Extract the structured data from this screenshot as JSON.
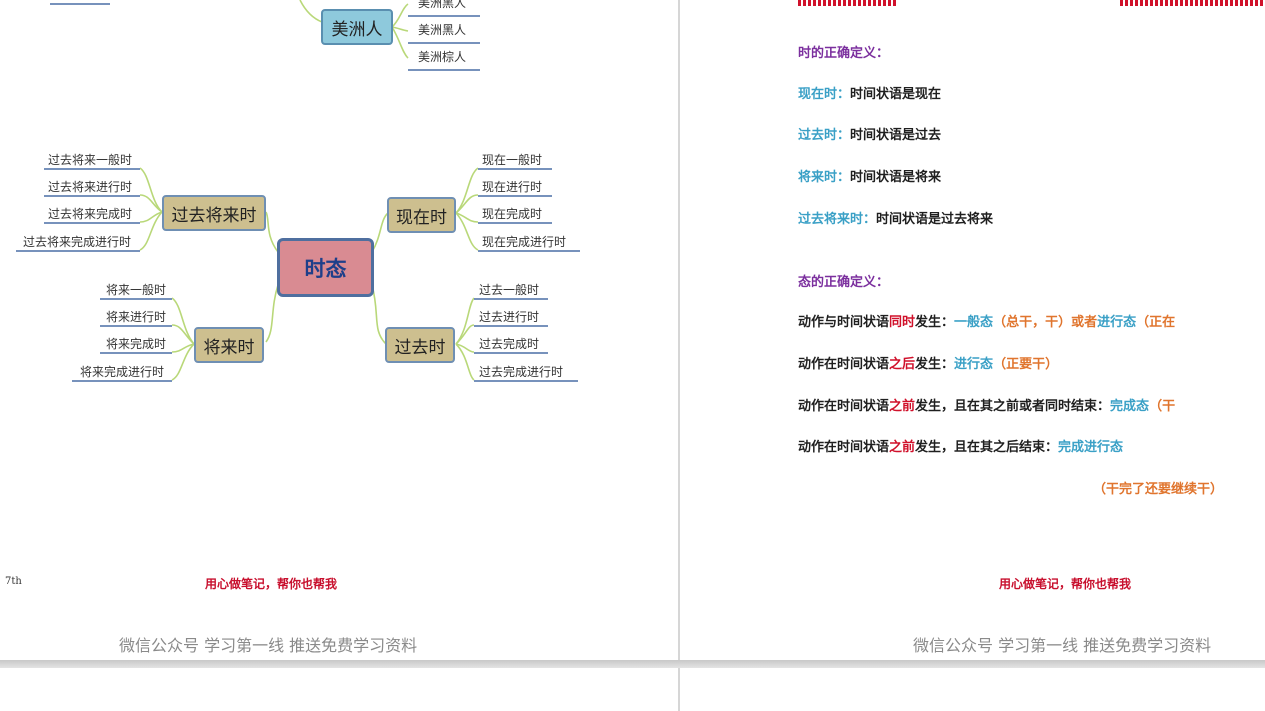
{
  "left_page": {
    "top_branch": {
      "node": "美洲人",
      "leaves": [
        "美洲黑人",
        "美洲黑人",
        "美洲棕人"
      ]
    },
    "root": "时态",
    "branches": [
      {
        "id": "past-future",
        "label": "过去将来时",
        "leaves": [
          "过去将来一般时",
          "过去将来进行时",
          "过去将来完成时",
          "过去将来完成进行时"
        ]
      },
      {
        "id": "present",
        "label": "现在时",
        "leaves": [
          "现在一般时",
          "现在进行时",
          "现在完成时",
          "现在完成进行时"
        ]
      },
      {
        "id": "future",
        "label": "将来时",
        "leaves": [
          "将来一般时",
          "将来进行时",
          "将来完成时",
          "将来完成进行时"
        ]
      },
      {
        "id": "past",
        "label": "过去时",
        "leaves": [
          "过去一般时",
          "过去进行时",
          "过去完成时",
          "过去完成进行时"
        ]
      }
    ],
    "page_number": "7th",
    "footer_note": "用心做笔记，帮你也帮我",
    "watermark": "微信公众号 学习第一线 推送免费学习资料"
  },
  "right_page": {
    "tense_heading": "时的正确定义：",
    "tense_defs": [
      {
        "term": "现在时：",
        "text": "时间状语是现在"
      },
      {
        "term": "过去时：",
        "text": "时间状语是过去"
      },
      {
        "term": "将来时：",
        "text": "时间状语是将来"
      },
      {
        "term": "过去将来时：",
        "text": "时间状语是过去将来"
      }
    ],
    "aspect_heading": "态的正确定义：",
    "aspect_defs": [
      {
        "p1": "动作与时间状语",
        "hl": "同时",
        "p2": "发生：",
        "b1": "一般态",
        "o1": "（总干，干）",
        "mid": "或者",
        "b2": "进行态",
        "o2": "（正在"
      },
      {
        "p1": "动作在时间状语",
        "hl": "之后",
        "p2": "发生：",
        "b1": "进行态",
        "o1": "（正要干）",
        "mid": "",
        "b2": "",
        "o2": ""
      },
      {
        "p1": "动作在时间状语",
        "hl": "之前",
        "p2": "发生，且在其之前或者同时结束：",
        "b1": "完成态",
        "o1": "（干",
        "mid": "",
        "b2": "",
        "o2": ""
      },
      {
        "p1": "动作在时间状语",
        "hl": "之前",
        "p2": "发生，且在其之后结束：",
        "b1": "完成进行态",
        "o1": "",
        "mid": "",
        "b2": "",
        "o2": ""
      }
    ],
    "aspect_note": "（干完了还要继续干）",
    "footer_note": "用心做笔记，帮你也帮我",
    "watermark": "微信公众号 学习第一线 推送免费学习资料"
  },
  "colors": {
    "accent_red": "#d0112b",
    "term_blue": "#3aa0c6",
    "heading_purple": "#7b2f9e",
    "note_orange": "#e0752e"
  }
}
